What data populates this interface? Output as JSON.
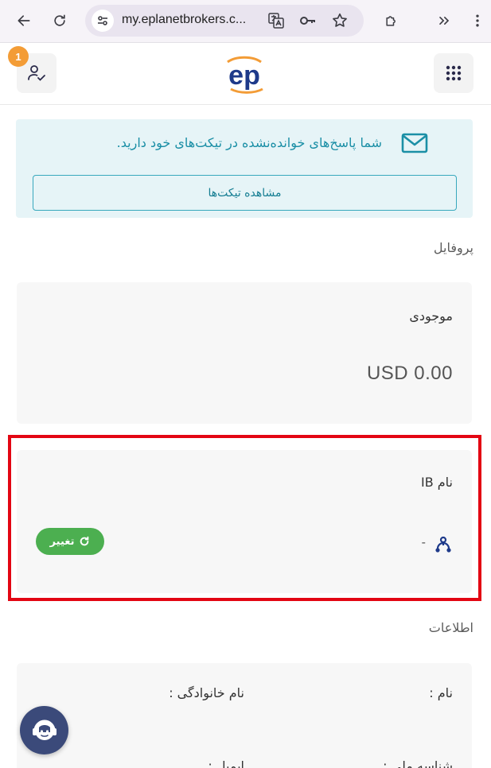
{
  "browser": {
    "url": "my.eplanetbrokers.c...",
    "icons": [
      "back-arrow-icon",
      "reload-icon",
      "site-settings-icon",
      "translate-icon",
      "password-key-icon",
      "bookmark-star-icon",
      "extensions-icon",
      "more-chevrons-icon",
      "menu-dots-icon"
    ]
  },
  "header": {
    "notification_count": "1",
    "logo_text": "ep",
    "colors": {
      "logo_blue": "#1e3a8a",
      "logo_orange": "#f39c36",
      "badge": "#f39c36"
    }
  },
  "alert": {
    "message": "شما پاسخ‌های خوانده‌نشده در تیکت‌های خود دارید.",
    "button_label": "مشاهده تیکت‌ها",
    "color": "#1b8fa6"
  },
  "profile": {
    "section_title": "پروفایل",
    "balance_label": "موجودی",
    "balance_value": "USD 0.00"
  },
  "ib": {
    "label": "نام IB",
    "value": "-",
    "change_label": "تغییر",
    "button_color": "#4caf50"
  },
  "info": {
    "section_title": "اطلاعات",
    "first_name_label": "نام :",
    "last_name_label": "نام خانوادگی :",
    "national_id_label": "شناسه ملی :",
    "email_label": "ایمیل :"
  }
}
